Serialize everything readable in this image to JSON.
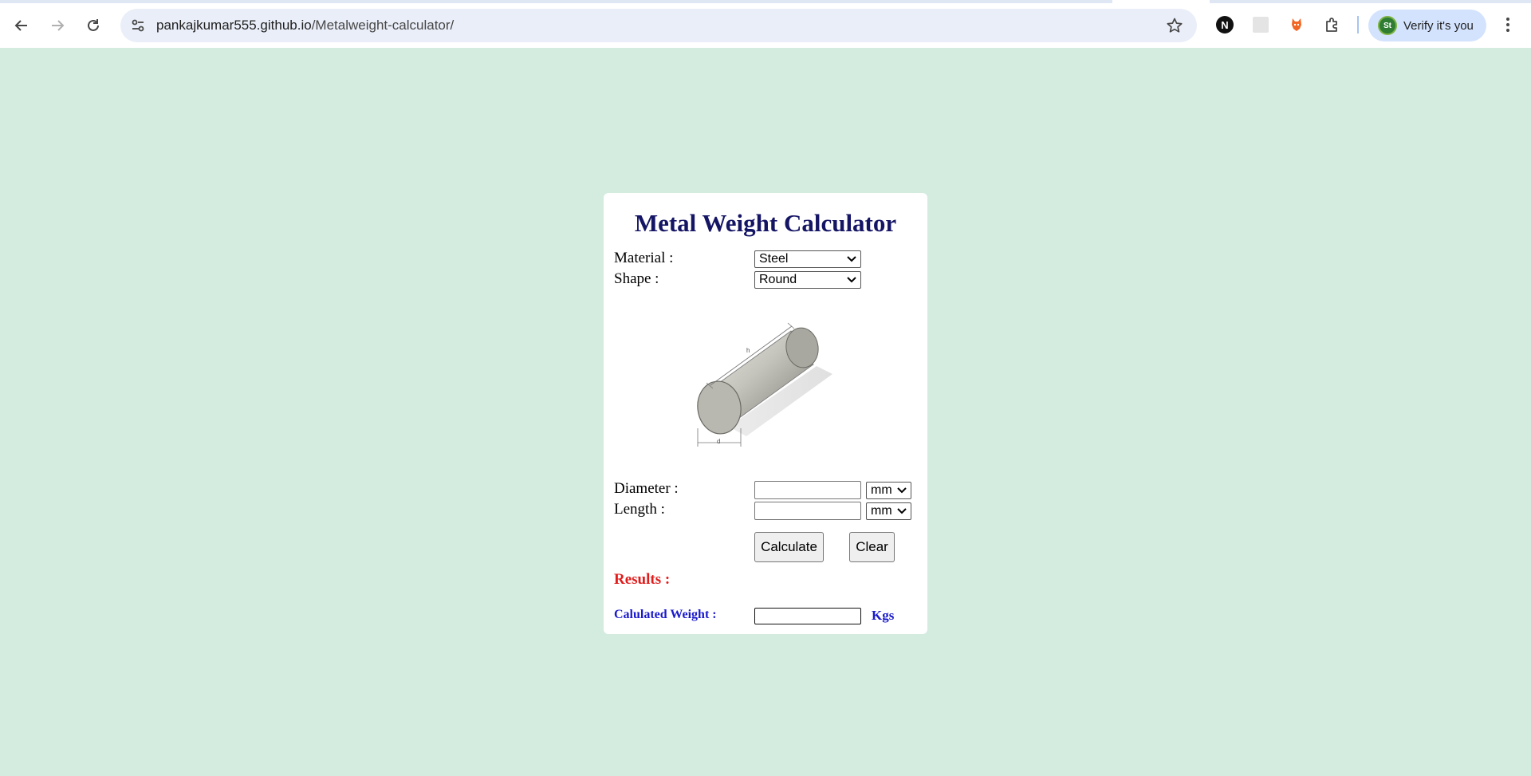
{
  "browser": {
    "url_host": "pankajkumar555.github.io",
    "url_path": "/Metalweight-calculator/",
    "extension_n_label": "N",
    "profile_initials": "St",
    "verify_label": "Verify it's you"
  },
  "calculator": {
    "title": "Metal Weight Calculator",
    "material_label": "Material :",
    "material_value": "Steel",
    "shape_label": "Shape :",
    "shape_value": "Round",
    "illustration_labels": {
      "length": "h",
      "diameter": "d"
    },
    "diameter_label": "Diameter :",
    "diameter_value": "",
    "diameter_unit": "mm",
    "length_label": "Length :",
    "length_value": "",
    "length_unit": "mm",
    "calculate_label": "Calculate",
    "clear_label": "Clear",
    "results_label": "Results :",
    "weight_label": "Calulated Weight :",
    "weight_value": "",
    "weight_unit": "Kgs"
  },
  "colors": {
    "page_background": "#d4ece0",
    "title": "#151565",
    "results": "#e21b1b",
    "weight_label": "#1a1acd"
  }
}
